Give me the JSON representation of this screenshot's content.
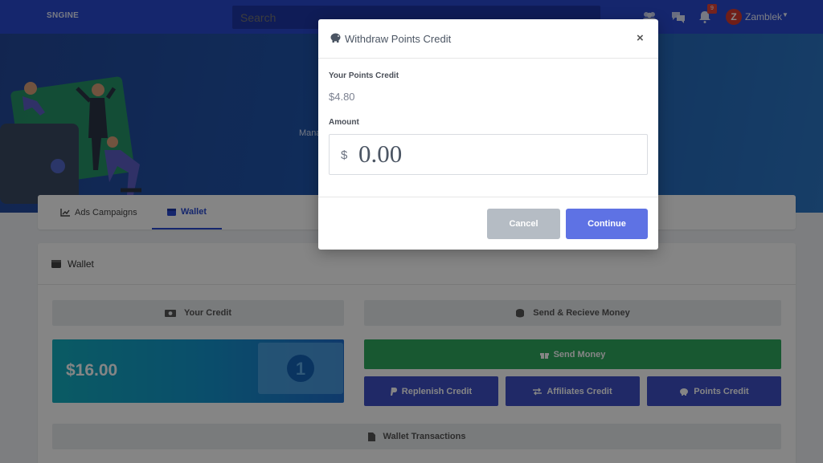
{
  "topbar": {
    "logo": "SNGINE",
    "search_placeholder": "Search",
    "notification_count": "9",
    "avatar_letter": "Z",
    "username": "Zamblek"
  },
  "hero": {
    "text": "Mana"
  },
  "tabs": [
    {
      "label": "Ads Campaigns",
      "icon": "chart-line-icon"
    },
    {
      "label": "Wallet",
      "icon": "wallet-icon",
      "active": true
    }
  ],
  "wallet": {
    "title": "Wallet",
    "your_credit_label": "Your Credit",
    "credit_amount": "$16.00",
    "send_receive_label": "Send & Recieve Money",
    "send_money_label": "Send Money",
    "replenish_label": "Replenish Credit",
    "affiliates_label": "Affiliates Credit",
    "points_label": "Points Credit",
    "transactions_label": "Wallet Transactions"
  },
  "modal": {
    "title": "Withdraw Points Credit",
    "close_symbol": "×",
    "points_credit_label": "Your Points Credit",
    "points_credit_value": "$4.80",
    "amount_label": "Amount",
    "currency_symbol": "$",
    "amount_placeholder": "0.00",
    "cancel_label": "Cancel",
    "continue_label": "Continue"
  },
  "colors": {
    "topbar": "#2a4ad1",
    "primary_button": "#5e72e4",
    "cancel_button": "#b5bcc4",
    "send_money": "#2faa5f",
    "credit_buttons": "#3f4fc6"
  }
}
